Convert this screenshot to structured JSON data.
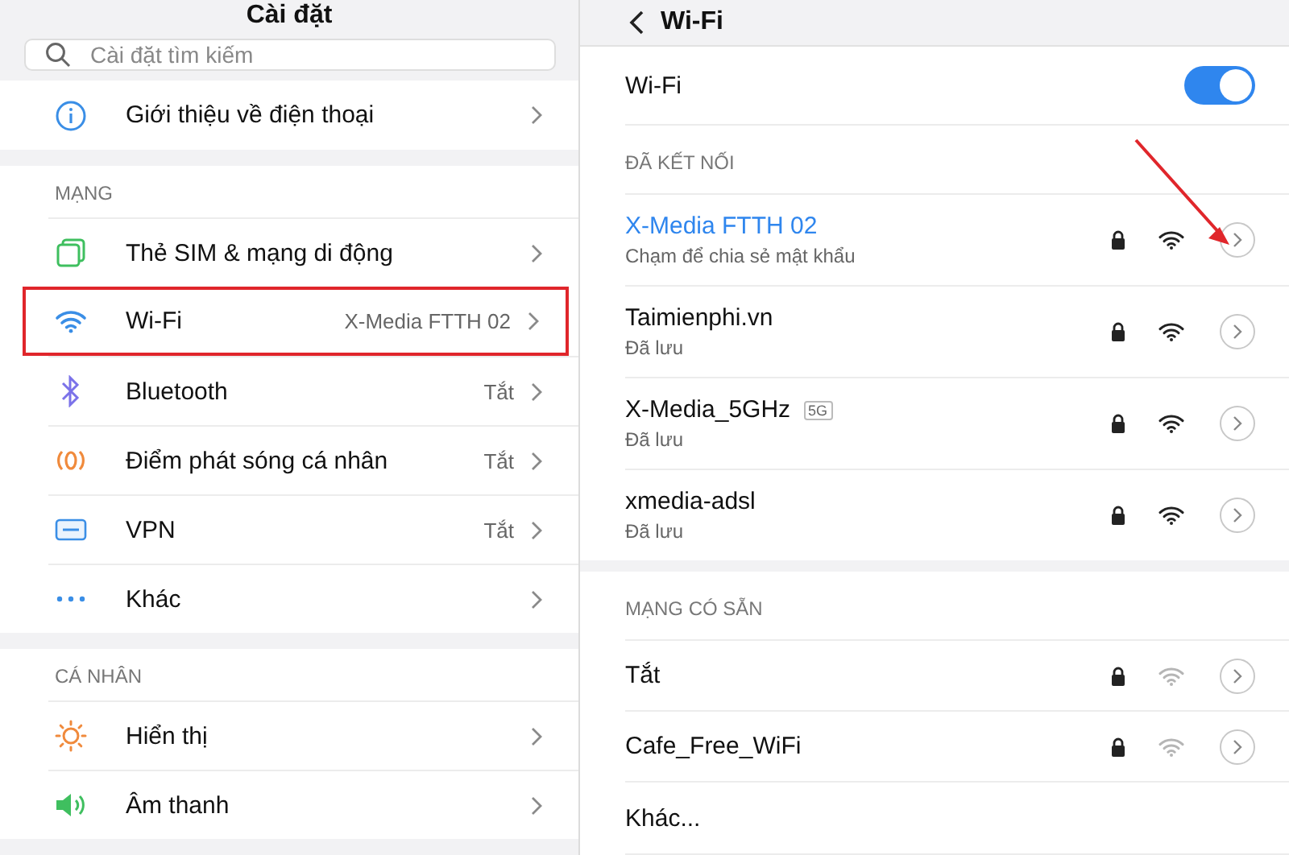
{
  "settings": {
    "title": "Cài đặt",
    "search": {
      "placeholder": "Cài đặt tìm kiếm"
    },
    "sections": [
      {
        "items": [
          {
            "kind": "info",
            "label": "Giới thiệu về điện thoại",
            "highlighted": false
          }
        ]
      },
      {
        "header": "MẠNG",
        "items": [
          {
            "kind": "sim",
            "label": "Thẻ SIM & mạng di động",
            "highlighted": false
          },
          {
            "kind": "wifi",
            "label": "Wi-Fi",
            "value": "X-Media FTTH 02",
            "highlighted": true
          },
          {
            "kind": "bluetooth",
            "label": "Bluetooth",
            "value": "Tắt",
            "highlighted": false
          },
          {
            "kind": "hotspot",
            "label": "Điểm phát sóng cá nhân",
            "value": "Tắt",
            "highlighted": false
          },
          {
            "kind": "vpn",
            "label": "VPN",
            "value": "Tắt",
            "highlighted": false
          },
          {
            "kind": "more",
            "label": "Khác",
            "highlighted": false
          }
        ]
      },
      {
        "header": "CÁ NHÂN",
        "items": [
          {
            "kind": "display",
            "label": "Hiển thị",
            "highlighted": false
          },
          {
            "kind": "sound",
            "label": "Âm thanh",
            "highlighted": false
          }
        ]
      }
    ]
  },
  "wifi": {
    "title": "Wi-Fi",
    "toggle": {
      "label": "Wi-Fi",
      "on": true
    },
    "groups": [
      {
        "header": "ĐÃ KẾT NỐI",
        "networks": [
          {
            "name": "X-Media FTTH 02",
            "subtitle": "Chạm để chia sẻ mật khẩu",
            "connected": true,
            "weak": false
          },
          {
            "name": "Taimienphi.vn",
            "subtitle": "Đã lưu",
            "connected": false,
            "weak": false
          },
          {
            "name": "X-Media_5GHz",
            "badge": "5G",
            "subtitle": "Đã lưu",
            "connected": false,
            "weak": false
          },
          {
            "name": "xmedia-adsl",
            "subtitle": "Đã lưu",
            "connected": false,
            "weak": false
          }
        ]
      },
      {
        "header": "MẠNG CÓ SẴN",
        "networks": [
          {
            "name": "Tắt",
            "connected": false,
            "weak": true
          },
          {
            "name": "Cafe_Free_WiFi",
            "connected": false,
            "weak": true
          }
        ]
      }
    ],
    "other": "Khác..."
  }
}
